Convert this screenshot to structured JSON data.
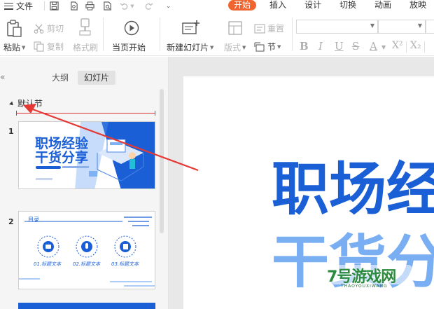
{
  "menubar": {
    "file_label": "文件",
    "tabs": [
      {
        "label": "开始",
        "active": true
      },
      {
        "label": "插入",
        "active": false
      },
      {
        "label": "设计",
        "active": false
      },
      {
        "label": "切换",
        "active": false
      },
      {
        "label": "动画",
        "active": false
      },
      {
        "label": "放映",
        "active": false
      }
    ],
    "quick_access_icons": [
      "save-icon",
      "export-pdf-icon",
      "print-icon",
      "print-preview-icon",
      "undo-icon",
      "redo-icon",
      "customize-icon"
    ]
  },
  "ribbon": {
    "paste": "粘贴",
    "cut": "剪切",
    "copy": "复制",
    "format_painter": "格式刷",
    "play_from_current": "当页开始",
    "new_slide": "新建幻灯片",
    "layout": "版式",
    "reset": "重置",
    "section": "节",
    "format_icons": [
      "B",
      "I",
      "U",
      "S",
      "A",
      "X²",
      "X₂"
    ]
  },
  "panel": {
    "collapse_icon": "«",
    "tab_outline": "大纲",
    "tab_slides": "幻灯片",
    "section_name": "默认节",
    "slide_numbers": [
      "1",
      "2"
    ]
  },
  "slide1": {
    "title_line1": "职场经验",
    "title_line2": "干货分享"
  },
  "slide2": {
    "heading": "目录",
    "items": [
      "01.标题文本",
      "02.标题文本",
      "03.标题文本"
    ]
  },
  "canvas": {
    "line1": "职场经",
    "line2": "干货分"
  },
  "colors": {
    "accent": "#f0652f",
    "slide_blue": "#1a5fd6",
    "arrow_red": "#e53935"
  },
  "watermark": {
    "brand": "7号游戏网",
    "sub": "THAOYOUXIWANG"
  }
}
